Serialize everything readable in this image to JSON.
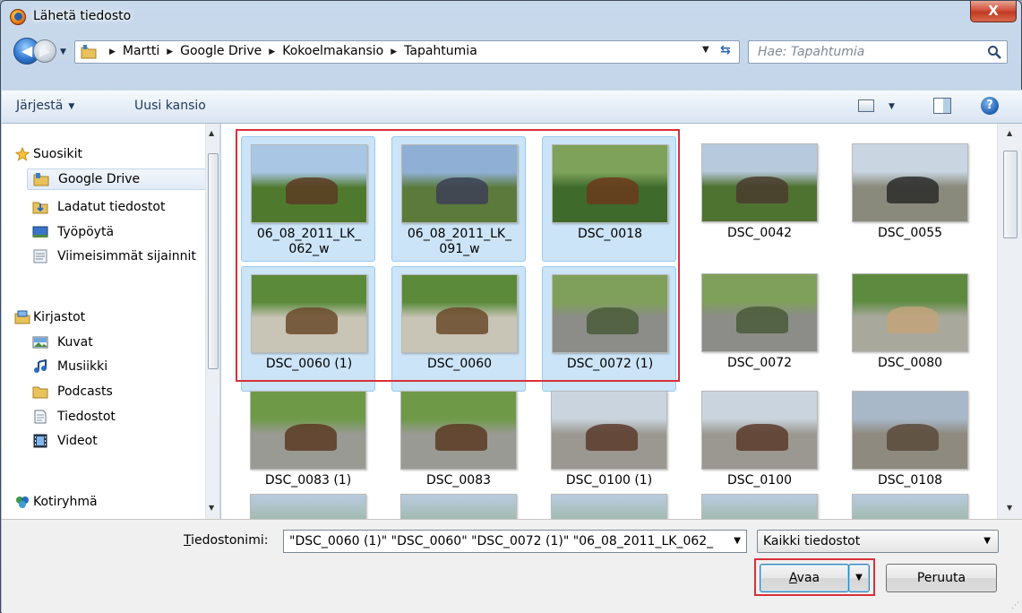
{
  "window": {
    "title": "Lähetä tiedosto",
    "close_label": "X"
  },
  "address": {
    "crumbs": [
      "Martti",
      "Google Drive",
      "Kokoelmakansio",
      "Tapahtumia"
    ]
  },
  "search": {
    "placeholder": "Hae: Tapahtumia"
  },
  "toolbar": {
    "organize_label": "Järjestä",
    "new_folder_label": "Uusi kansio",
    "help_label": "?"
  },
  "sidebar": {
    "items": [
      {
        "label": "Suosikit",
        "icon": "star-icon"
      },
      {
        "label": "Google Drive",
        "icon": "google-drive-folder-icon",
        "selected": true
      },
      {
        "label": "Ladatut tiedostot",
        "icon": "downloads-folder-icon"
      },
      {
        "label": "Työpöytä",
        "icon": "desktop-icon"
      },
      {
        "label": "Viimeisimmät sijainnit",
        "icon": "recent-places-icon"
      },
      {
        "label": "Kirjastot",
        "icon": "libraries-icon"
      },
      {
        "label": "Kuvat",
        "icon": "pictures-icon"
      },
      {
        "label": "Musiikki",
        "icon": "music-icon"
      },
      {
        "label": "Podcasts",
        "icon": "podcasts-folder-icon"
      },
      {
        "label": "Tiedostot",
        "icon": "documents-icon"
      },
      {
        "label": "Videot",
        "icon": "videos-icon"
      },
      {
        "label": "Kotiryhmä",
        "icon": "homegroup-icon"
      }
    ]
  },
  "files": [
    {
      "name": "06_08_2011_LK_\n062_w",
      "selected": true,
      "colors": [
        "#a9c6e4",
        "#4f7a2e",
        "#5a3b22"
      ]
    },
    {
      "name": "06_08_2011_LK_\n091_w",
      "selected": true,
      "colors": [
        "#8fb0d4",
        "#5c7a3c",
        "#3c3f55"
      ]
    },
    {
      "name": "DSC_0018",
      "selected": true,
      "colors": [
        "#7ea25a",
        "#3e6a2c",
        "#6b3a1c"
      ]
    },
    {
      "name": "DSC_0042",
      "selected": false,
      "colors": [
        "#b7c9dc",
        "#4e7230",
        "#4a3b2e"
      ]
    },
    {
      "name": "DSC_0055",
      "selected": false,
      "colors": [
        "#c9d6e2",
        "#8a8a7c",
        "#2a2a2a"
      ]
    },
    {
      "name": "DSC_0060 (1)",
      "selected": true,
      "colors": [
        "#5a8a3a",
        "#c8c4b6",
        "#6a4a2a"
      ]
    },
    {
      "name": "DSC_0060",
      "selected": true,
      "colors": [
        "#5a8a3a",
        "#c8c4b6",
        "#6a4a2a"
      ]
    },
    {
      "name": "DSC_0072 (1)",
      "selected": true,
      "colors": [
        "#7fa05a",
        "#8c8c88",
        "#4a5a3a"
      ]
    },
    {
      "name": "DSC_0072",
      "selected": false,
      "colors": [
        "#7fa05a",
        "#8c8c88",
        "#4a5a3a"
      ]
    },
    {
      "name": "DSC_0080",
      "selected": false,
      "colors": [
        "#5e8a40",
        "#a8a89c",
        "#c2a47a"
      ]
    },
    {
      "name": "DSC_0083 (1)",
      "selected": false,
      "colors": [
        "#6e9a48",
        "#9a9a94",
        "#5a3a22"
      ]
    },
    {
      "name": "DSC_0083",
      "selected": false,
      "colors": [
        "#6e9a48",
        "#9a9a94",
        "#5a3a22"
      ]
    },
    {
      "name": "DSC_0100 (1)",
      "selected": false,
      "colors": [
        "#c9d4de",
        "#9a9890",
        "#5a3a2a"
      ]
    },
    {
      "name": "DSC_0100",
      "selected": false,
      "colors": [
        "#c9d4de",
        "#9a9890",
        "#5a3a2a"
      ]
    },
    {
      "name": "DSC_0108",
      "selected": false,
      "colors": [
        "#a8b8c8",
        "#8e8a80",
        "#5a4a3a"
      ]
    }
  ],
  "bottom": {
    "filename_label_first": "T",
    "filename_label_rest": "iedostonimi:",
    "filename_value": "\"DSC_0060 (1)\" \"DSC_0060\" \"DSC_0072 (1)\" \"06_08_2011_LK_062_",
    "filter_value": "Kaikki tiedostot",
    "open_first": "A",
    "open_rest": "vaa",
    "cancel_label": "Peruuta"
  },
  "colors": {
    "selection_outline": "#d9303a",
    "selected_tile_bg": "#cce4f7"
  }
}
